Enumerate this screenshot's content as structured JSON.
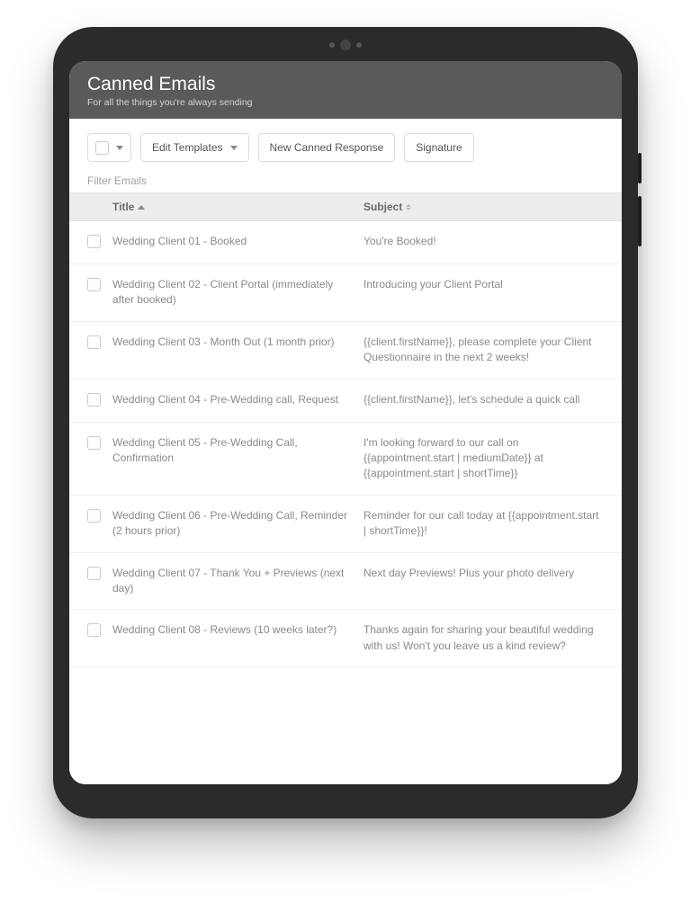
{
  "header": {
    "title": "Canned Emails",
    "subtitle": "For all the things you're always sending"
  },
  "toolbar": {
    "edit_templates": "Edit Templates",
    "new_response": "New Canned Response",
    "signature": "Signature"
  },
  "filter_label": "Filter Emails",
  "columns": {
    "title": "Title",
    "subject": "Subject"
  },
  "rows": [
    {
      "title": "Wedding Client 01 - Booked",
      "subject": "You're Booked!"
    },
    {
      "title": "Wedding Client 02 - Client Portal (immediately after booked)",
      "subject": "Introducing your Client Portal"
    },
    {
      "title": "Wedding Client 03 - Month Out (1 month prior)",
      "subject": "{{client.firstName}}, please complete your Client Questionnaire in the next 2 weeks!"
    },
    {
      "title": "Wedding Client 04 - Pre-Wedding call, Request",
      "subject": "{{client.firstName}}, let's schedule a quick call"
    },
    {
      "title": "Wedding Client 05 - Pre-Wedding Call, Confirmation",
      "subject": "I'm looking forward to our call on {{appointment.start | mediumDate}} at {{appointment.start | shortTime}}"
    },
    {
      "title": "Wedding Client 06 - Pre-Wedding Call, Reminder (2 hours prior)",
      "subject": "Reminder for our call today at {{appointment.start | shortTime}}!"
    },
    {
      "title": "Wedding Client 07 - Thank You + Previews (next day)",
      "subject": "Next day Previews! Plus your photo delivery"
    },
    {
      "title": "Wedding Client 08 - Reviews (10 weeks later?)",
      "subject": "Thanks again for sharing your beautiful wedding with us! Won't you leave us a kind review?"
    }
  ]
}
